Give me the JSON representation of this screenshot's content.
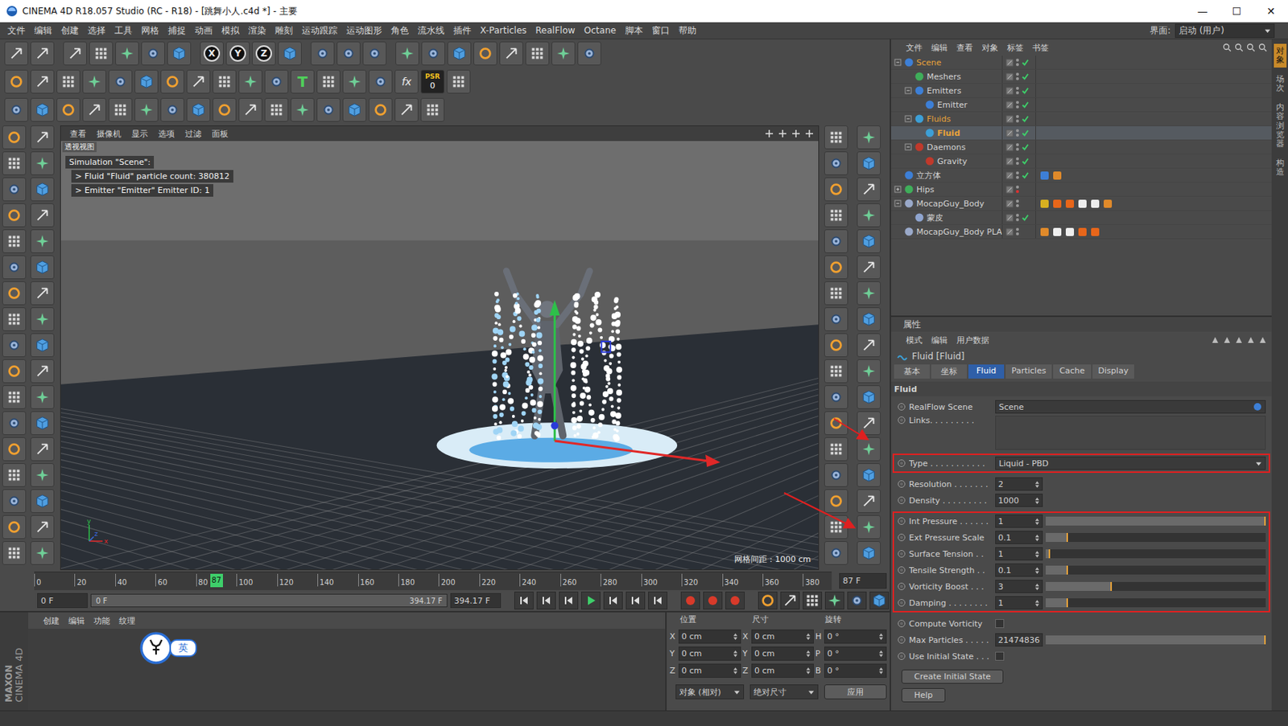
{
  "window": {
    "title": "CINEMA 4D R18.057 Studio (RC - R18) - [跳舞小人.c4d *] - 主要",
    "controls": [
      "—",
      "☐",
      "✕"
    ]
  },
  "menubar": {
    "items": [
      "文件",
      "编辑",
      "创建",
      "选择",
      "工具",
      "网格",
      "捕捉",
      "动画",
      "模拟",
      "渲染",
      "雕刻",
      "运动跟踪",
      "运动图形",
      "角色",
      "流水线",
      "插件",
      "X-Particles",
      "RealFlow",
      "Octane",
      "脚本",
      "窗口",
      "帮助"
    ],
    "layout_label": "界面:",
    "layout_value": "启动 (用户)"
  },
  "toolbar": {
    "axis": [
      "X",
      "Y",
      "Z"
    ],
    "text_tool": "T",
    "fx": "fx",
    "psr": [
      "PSR",
      "0"
    ]
  },
  "viewport": {
    "menu": [
      "查看",
      "摄像机",
      "显示",
      "选项",
      "过滤",
      "面板"
    ],
    "label": "透视视图",
    "hud": [
      "Simulation \"Scene\":",
      "> Fluid \"Fluid\" particle count: 380812",
      "> Emitter \"Emitter\" Emitter ID: 1"
    ],
    "grid_info": "网格间距 : 1000 cm",
    "axes": [
      "y",
      "z",
      "x"
    ]
  },
  "timeline": {
    "ticks": [
      "0",
      "20",
      "40",
      "60",
      "80",
      "100",
      "120",
      "140",
      "160",
      "180",
      "200",
      "220",
      "240",
      "260",
      "280",
      "300",
      "320",
      "340",
      "360",
      "380"
    ],
    "current": "87",
    "frame_field": "87 F",
    "start_field": "0 F",
    "range_start": "0 F",
    "range_end": "394.17 F",
    "end_field": "394.17 F"
  },
  "material_manager": {
    "menu": [
      "创建",
      "编辑",
      "功能",
      "纹理"
    ],
    "ime_badge": "英"
  },
  "logo": [
    "MAXON",
    "CINEMA 4D"
  ],
  "coordinates": {
    "headers": [
      "位置",
      "尺寸",
      "旋转"
    ],
    "rows": [
      {
        "labels": [
          "X",
          "X",
          "H"
        ],
        "values": [
          "0 cm",
          "0 cm",
          "0 °"
        ]
      },
      {
        "labels": [
          "Y",
          "Y",
          "P"
        ],
        "values": [
          "0 cm",
          "0 cm",
          "0 °"
        ]
      },
      {
        "labels": [
          "Z",
          "Z",
          "B"
        ],
        "values": [
          "0 cm",
          "0 cm",
          "0 °"
        ]
      }
    ],
    "dropdowns": [
      "对象 (相对)",
      "绝对尺寸"
    ],
    "apply": "应用"
  },
  "object_manager": {
    "menu": [
      "文件",
      "编辑",
      "查看",
      "对象",
      "标签",
      "书签"
    ],
    "rows": [
      {
        "name": "Scene",
        "depth": 0,
        "expandable": true,
        "expanded": true,
        "selected": false,
        "checked": true,
        "disabled": false,
        "color": "#e8a23a",
        "icon_color": "#3d7fd6",
        "tags": []
      },
      {
        "name": "Meshers",
        "depth": 1,
        "expandable": false,
        "expanded": false,
        "selected": false,
        "checked": true,
        "disabled": false,
        "color": "#d4d4d4",
        "icon_color": "#3fae5a",
        "tags": []
      },
      {
        "name": "Emitters",
        "depth": 1,
        "expandable": true,
        "expanded": true,
        "selected": false,
        "checked": true,
        "disabled": false,
        "color": "#d4d4d4",
        "icon_color": "#3d7fd6",
        "tags": []
      },
      {
        "name": "Emitter",
        "depth": 2,
        "expandable": false,
        "expanded": false,
        "selected": false,
        "checked": true,
        "disabled": false,
        "color": "#d4d4d4",
        "icon_color": "#3d7fd6",
        "tags": []
      },
      {
        "name": "Fluids",
        "depth": 1,
        "expandable": true,
        "expanded": true,
        "selected": false,
        "checked": true,
        "disabled": false,
        "color": "#e8a23a",
        "icon_color": "#3d9fd6",
        "tags": []
      },
      {
        "name": "Fluid",
        "depth": 2,
        "expandable": false,
        "expanded": false,
        "selected": true,
        "checked": true,
        "disabled": false,
        "color": "#e8a23a",
        "icon_color": "#3d9fd6",
        "tags": []
      },
      {
        "name": "Daemons",
        "depth": 1,
        "expandable": true,
        "expanded": true,
        "selected": false,
        "checked": true,
        "disabled": false,
        "color": "#d4d4d4",
        "icon_color": "#c0392b",
        "tags": []
      },
      {
        "name": "Gravity",
        "depth": 2,
        "expandable": false,
        "expanded": false,
        "selected": false,
        "checked": true,
        "disabled": false,
        "color": "#d4d4d4",
        "icon_color": "#c0392b",
        "tags": []
      },
      {
        "name": "立方体",
        "depth": 0,
        "expandable": false,
        "expanded": false,
        "selected": false,
        "checked": true,
        "disabled": false,
        "color": "#d4d4d4",
        "icon_color": "#3d7fd6",
        "tags": [
          "#3d7fd6",
          "#e08a2a"
        ]
      },
      {
        "name": "Hips",
        "depth": 0,
        "expandable": true,
        "expanded": false,
        "selected": false,
        "checked": false,
        "disabled": true,
        "color": "#d4d4d4",
        "icon_color": "#3fae5a",
        "tags": []
      },
      {
        "name": "MocapGuy_Body",
        "depth": 0,
        "expandable": true,
        "expanded": true,
        "selected": false,
        "checked": false,
        "disabled": false,
        "color": "#d4d4d4",
        "icon_color": "#9aa9c9",
        "tags": [
          "#d8b020",
          "#e8661a",
          "#e8661a",
          "#eeeeee",
          "#eeeeee",
          "#e08a2a"
        ]
      },
      {
        "name": "蒙皮",
        "depth": 1,
        "expandable": false,
        "expanded": false,
        "selected": false,
        "checked": true,
        "disabled": false,
        "color": "#d4d4d4",
        "icon_color": "#8fa5d0",
        "tags": []
      },
      {
        "name": "MocapGuy_Body PLA",
        "depth": 0,
        "expandable": false,
        "expanded": false,
        "selected": false,
        "checked": false,
        "disabled": false,
        "color": "#d4d4d4",
        "icon_color": "#9aa9c9",
        "tags": [
          "#e08a2a",
          "#eeeeee",
          "#eeeeee",
          "#e8661a",
          "#e8661a"
        ]
      }
    ]
  },
  "side_tabs": [
    {
      "label": "对象",
      "selected": true
    },
    {
      "label": "场次",
      "selected": false
    },
    {
      "label": "内容浏览器",
      "selected": false
    },
    {
      "label": "构造",
      "selected": false
    }
  ],
  "attributes": {
    "header": "属性",
    "menu": [
      "模式",
      "编辑",
      "用户数据"
    ],
    "title": "Fluid [Fluid]",
    "tabs": [
      {
        "label": "基本",
        "selected": false
      },
      {
        "label": "坐标",
        "selected": false
      },
      {
        "label": "Fluid",
        "selected": true
      },
      {
        "label": "Particles",
        "selected": false
      },
      {
        "label": "Cache",
        "selected": false
      },
      {
        "label": "Display",
        "selected": false
      }
    ],
    "section": "Fluid",
    "groups": [
      {
        "highlighted": false,
        "fields": [
          {
            "kind": "link",
            "label": "RealFlow Scene",
            "value": "Scene"
          },
          {
            "kind": "list",
            "label": "Links. . . . . . . . ."
          }
        ]
      },
      {
        "highlighted": true,
        "fields": [
          {
            "kind": "dropdown",
            "label": "Type . . . . . . . . . . .",
            "value": "Liquid - PBD"
          }
        ]
      },
      {
        "highlighted": false,
        "fields": [
          {
            "kind": "number",
            "label": "Resolution . . . . . . .",
            "value": "2"
          },
          {
            "kind": "number",
            "label": "Density . . . . . . . . .",
            "value": "1000"
          }
        ]
      },
      {
        "highlighted": true,
        "fields": [
          {
            "kind": "slider",
            "label": "Int Pressure . . . . . .",
            "value": "1",
            "level": 1.0
          },
          {
            "kind": "slider",
            "label": "Ext Pressure Scale",
            "value": "0.1",
            "level": 0.1
          },
          {
            "kind": "slider",
            "label": "Surface Tension . .",
            "value": "1",
            "level": 0.02
          },
          {
            "kind": "slider",
            "label": "Tensile Strength . .",
            "value": "0.1",
            "level": 0.1
          },
          {
            "kind": "slider",
            "label": "Vorticity Boost . . .",
            "value": "3",
            "level": 0.3
          },
          {
            "kind": "slider",
            "label": "Damping . . . . . . . .",
            "value": "1",
            "level": 0.1
          }
        ]
      },
      {
        "highlighted": false,
        "fields": [
          {
            "kind": "checkbox",
            "label": "Compute Vorticity",
            "checked": false
          },
          {
            "kind": "slider",
            "label": "Max Particles . . . . .",
            "value": "21474836",
            "level": 1.0
          },
          {
            "kind": "checkbox",
            "label": "Use Initial State . . .",
            "checked": false
          }
        ]
      }
    ],
    "buttons": [
      "Create Initial State",
      "Help"
    ]
  }
}
